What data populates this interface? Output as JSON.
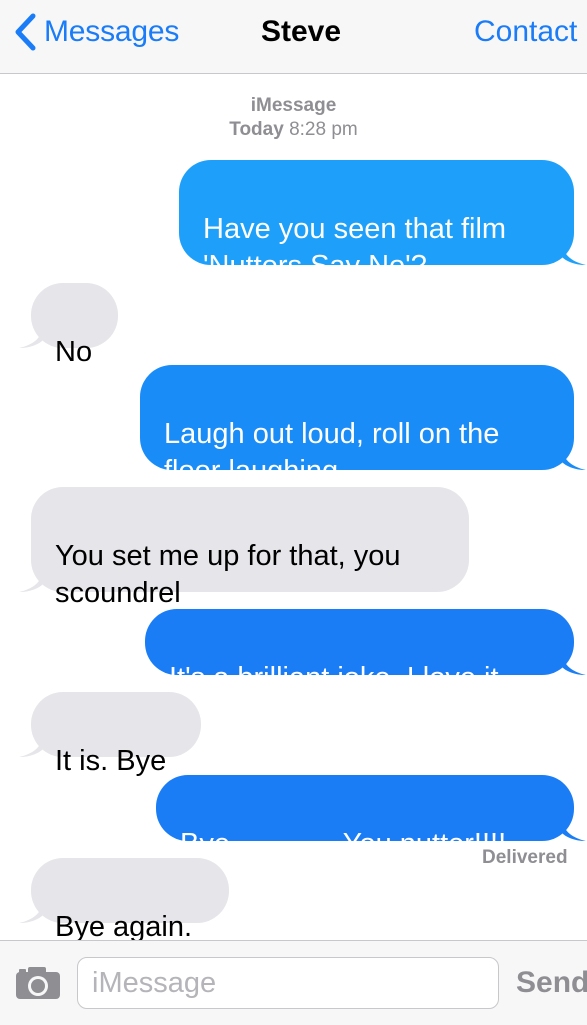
{
  "nav": {
    "back_label": "Messages",
    "title": "Steve",
    "contact_label": "Contact",
    "accent_color": "#1a7cf7"
  },
  "conversation": {
    "service": "iMessage",
    "day": "Today",
    "time": "8:28 pm"
  },
  "messages": [
    {
      "direction": "sent",
      "text": "Have you seen that film\n'Nutters Say No'?"
    },
    {
      "direction": "received",
      "text": "No"
    },
    {
      "direction": "sent",
      "text": "Laugh out loud, roll on the\nfloor laughing."
    },
    {
      "direction": "received",
      "text": "You set me up for that, you\nscoundrel"
    },
    {
      "direction": "sent",
      "text": "It's a brilliant joke. I love it."
    },
    {
      "direction": "received",
      "text": "It is. Bye"
    },
    {
      "direction": "sent",
      "text": "Bye..............You nutter!!!!"
    },
    {
      "direction": "received",
      "text": "Bye again."
    }
  ],
  "status": {
    "delivered": "Delivered"
  },
  "input_bar": {
    "placeholder": "iMessage",
    "send_label": "Send",
    "camera_icon": "camera-icon"
  },
  "colors": {
    "sent_bubble": "#1ea0fa",
    "sent_bubble_dark": "#1a7df5",
    "received_bubble": "#e5e5ea",
    "meta_text": "#8e8e93"
  }
}
